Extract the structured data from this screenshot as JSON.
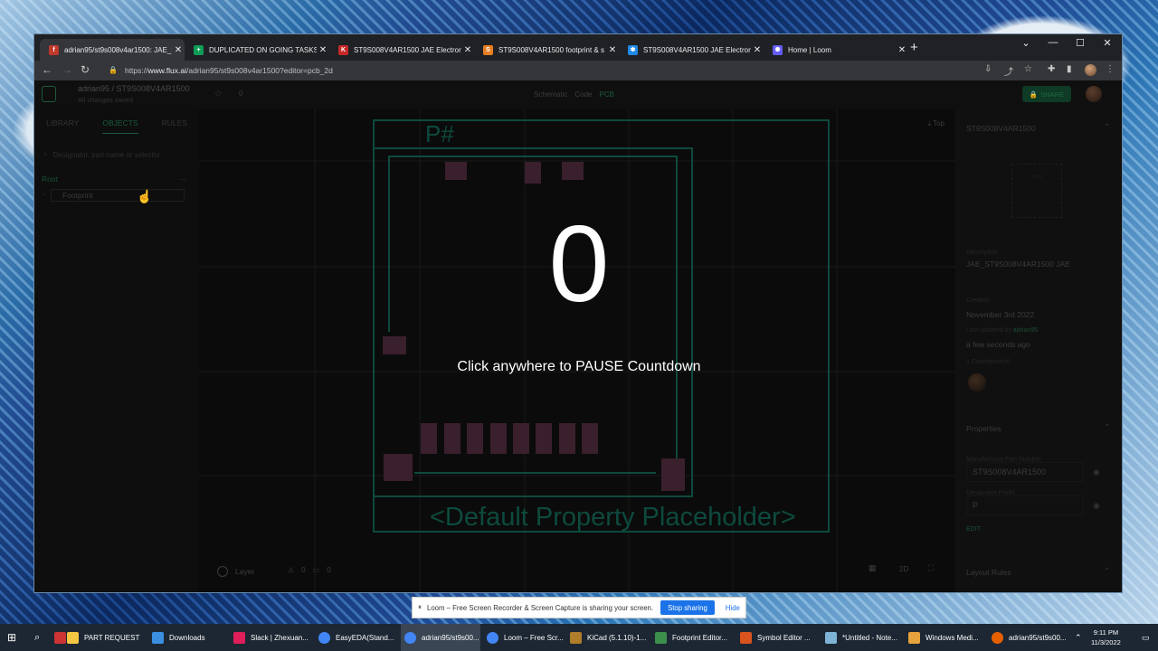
{
  "browser": {
    "tabs": [
      {
        "title": "adrian95/st9s008v4ar1500: JAE_S",
        "favicon_color": "#c0392b",
        "active": true
      },
      {
        "title": "DUPLICATED ON GOING TASKS",
        "favicon_color": "#0f9d58",
        "active": false
      },
      {
        "title": "ST9S008V4AR1500 JAE Electronic",
        "favicon_color": "#c62828",
        "active": false
      },
      {
        "title": "ST9S008V4AR1500 footprint & s",
        "favicon_color": "#e67e22",
        "active": false
      },
      {
        "title": "ST9S008V4AR1500 JAE Electronic",
        "favicon_color": "#1e88e5",
        "active": false
      },
      {
        "title": "Home | Loom",
        "favicon_color": "#625df5",
        "active": false
      }
    ],
    "url_prefix": "https://",
    "url_host": "www.flux.ai",
    "url_path": "/adrian95/st9s008v4ar1500?editor=pcb_2d"
  },
  "app": {
    "project_path": "adrian95 / ST9S008V4AR1500",
    "save_status": "All changes saved",
    "star_count": "0",
    "modes": [
      "Schematic",
      "Code",
      "PCB"
    ],
    "active_mode": "PCB",
    "share_label": "SHARE",
    "left_tabs": [
      "LIBRARY",
      "OBJECTS",
      "RULES"
    ],
    "active_left_tab": "OBJECTS",
    "search_placeholder": "Designator, part name or selector",
    "tree_root": "Root",
    "tree_child": "Footprint",
    "canvas_view_label": "Top",
    "canvas_designator": "P#",
    "canvas_placeholder": "<Default Property Placeholder>",
    "layer_label": "Layer",
    "warnings": "0",
    "comments": "0",
    "view_mode": "2D",
    "pcb_accent": "#16b38a"
  },
  "inspector": {
    "part_title": "ST9S008V4AR1500",
    "description_label": "Description",
    "description": "JAE_ST9S008V4AR1500 JAE",
    "created_label": "Created",
    "created": "November 3rd 2022",
    "updated_label": "Last updated by",
    "updated_by": "adrian95",
    "updated_when": "a few seconds ago",
    "contributors": "1 Contributor(s)",
    "properties_label": "Properties",
    "mpn_label": "Manufacturer Part Number",
    "mpn": "ST9S008V4AR1500",
    "prefix_label": "Designator Prefix",
    "prefix": "P",
    "edit_label": "EDIT",
    "layout_rules_label": "Layout Rules"
  },
  "overlay": {
    "countdown": "0",
    "hint": "Click anywhere to PAUSE Countdown"
  },
  "loom": {
    "message": "Loom – Free Screen Recorder & Screen Capture is sharing your screen.",
    "stop_label": "Stop sharing",
    "hide_label": "Hide"
  },
  "taskbar": {
    "items": [
      {
        "label": "PART REQUEST",
        "color": "#f4c542"
      },
      {
        "label": "Downloads",
        "color": "#3b8fe0"
      },
      {
        "label": "Slack | Zhexuan...",
        "color": "#e01e5a"
      },
      {
        "label": "EasyEDA(Stand...",
        "color": "#4285f4"
      },
      {
        "label": "adrian95/st9s00...",
        "color": "#4285f4"
      },
      {
        "label": "Loom – Free Scr...",
        "color": "#4285f4"
      },
      {
        "label": "KiCad (5.1.10)-1...",
        "color": "#b07d2b"
      },
      {
        "label": "Footprint Editor...",
        "color": "#3c8f4a"
      },
      {
        "label": "Symbol Editor ...",
        "color": "#d9531e"
      },
      {
        "label": "*Untitled - Note...",
        "color": "#7fb3d5"
      },
      {
        "label": "Windows Medi...",
        "color": "#e6a23c"
      },
      {
        "label": "adrian95/st9s00...",
        "color": "#e66000"
      }
    ],
    "time": "9:11 PM",
    "date": "11/3/2022"
  }
}
